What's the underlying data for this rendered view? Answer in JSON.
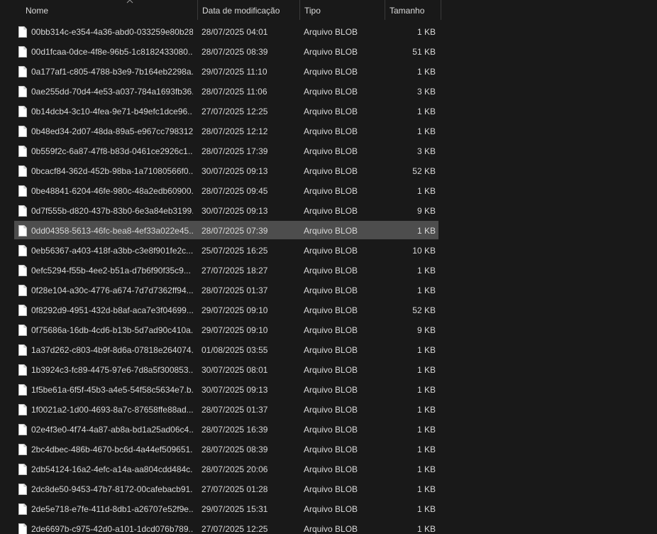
{
  "columns": {
    "name": "Nome",
    "date": "Data de modificação",
    "type": "Tipo",
    "size": "Tamanho"
  },
  "sort_icon": "sort-ascending-icon",
  "file_icon": "blank-file-icon",
  "selected_index": 10,
  "rows": [
    {
      "name": "00bb314c-e354-4a36-abd0-033259e80b28...",
      "date": "28/07/2025 04:01",
      "type": "Arquivo BLOB",
      "size": "1 KB"
    },
    {
      "name": "00d1fcaa-0dce-4f8e-96b5-1c8182433080...",
      "date": "28/07/2025 08:39",
      "type": "Arquivo BLOB",
      "size": "51 KB"
    },
    {
      "name": "0a177af1-c805-4788-b3e9-7b164eb2298a...",
      "date": "29/07/2025 11:10",
      "type": "Arquivo BLOB",
      "size": "1 KB"
    },
    {
      "name": "0ae255dd-70d4-4e53-a037-784a1693fb36...",
      "date": "28/07/2025 11:06",
      "type": "Arquivo BLOB",
      "size": "3 KB"
    },
    {
      "name": "0b14dcb4-3c10-4fea-9e71-b49efc1dce96...",
      "date": "27/07/2025 12:25",
      "type": "Arquivo BLOB",
      "size": "1 KB"
    },
    {
      "name": "0b48ed34-2d07-48da-89a5-e967cc798312...",
      "date": "28/07/2025 12:12",
      "type": "Arquivo BLOB",
      "size": "1 KB"
    },
    {
      "name": "0b559f2c-6a87-47f8-b83d-0461ce2926c1...",
      "date": "28/07/2025 17:39",
      "type": "Arquivo BLOB",
      "size": "3 KB"
    },
    {
      "name": "0bcacf84-362d-452b-98ba-1a71080566f0...",
      "date": "30/07/2025 09:13",
      "type": "Arquivo BLOB",
      "size": "52 KB"
    },
    {
      "name": "0be48841-6204-46fe-980c-48a2edb60900...",
      "date": "28/07/2025 09:45",
      "type": "Arquivo BLOB",
      "size": "1 KB"
    },
    {
      "name": "0d7f555b-d820-437b-83b0-6e3a84eb3199...",
      "date": "30/07/2025 09:13",
      "type": "Arquivo BLOB",
      "size": "9 KB"
    },
    {
      "name": "0dd04358-5613-46fc-bea8-4ef33a022e45...",
      "date": "28/07/2025 07:39",
      "type": "Arquivo BLOB",
      "size": "1 KB"
    },
    {
      "name": "0eb56367-a403-418f-a3bb-c3e8f901fe2c...",
      "date": "25/07/2025 16:25",
      "type": "Arquivo BLOB",
      "size": "10 KB"
    },
    {
      "name": "0efc5294-f55b-4ee2-b51a-d7b6f90f35c9...",
      "date": "27/07/2025 18:27",
      "type": "Arquivo BLOB",
      "size": "1 KB"
    },
    {
      "name": "0f28e104-a30c-4776-a674-7d7d7362ff94...",
      "date": "28/07/2025 01:37",
      "type": "Arquivo BLOB",
      "size": "1 KB"
    },
    {
      "name": "0f8292d9-4951-432d-b8af-aca7e3f04699...",
      "date": "29/07/2025 09:10",
      "type": "Arquivo BLOB",
      "size": "52 KB"
    },
    {
      "name": "0f75686a-16db-4cd6-b13b-5d7ad90c410a...",
      "date": "29/07/2025 09:10",
      "type": "Arquivo BLOB",
      "size": "9 KB"
    },
    {
      "name": "1a37d262-c803-4b9f-8d6a-07818e264074...",
      "date": "01/08/2025 03:55",
      "type": "Arquivo BLOB",
      "size": "1 KB"
    },
    {
      "name": "1b3924c3-fc89-4475-97e6-7d8a5f300853...",
      "date": "30/07/2025 08:01",
      "type": "Arquivo BLOB",
      "size": "1 KB"
    },
    {
      "name": "1f5be61a-6f5f-45b3-a4e5-54f58c5634e7.b...",
      "date": "30/07/2025 09:13",
      "type": "Arquivo BLOB",
      "size": "1 KB"
    },
    {
      "name": "1f0021a2-1d00-4693-8a7c-87658ffe88ad....",
      "date": "28/07/2025 01:37",
      "type": "Arquivo BLOB",
      "size": "1 KB"
    },
    {
      "name": "02e4f3e0-4f74-4a87-ab8a-bd1a25ad06c4....",
      "date": "28/07/2025 16:39",
      "type": "Arquivo BLOB",
      "size": "1 KB"
    },
    {
      "name": "2bc4dbec-486b-4670-bc6d-4a44ef509651...",
      "date": "28/07/2025 08:39",
      "type": "Arquivo BLOB",
      "size": "1 KB"
    },
    {
      "name": "2db54124-16a2-4efc-a14a-aa804cdd484c....",
      "date": "28/07/2025 20:06",
      "type": "Arquivo BLOB",
      "size": "1 KB"
    },
    {
      "name": "2dc8de50-9453-47b7-8172-00cafebacb91...",
      "date": "27/07/2025 01:28",
      "type": "Arquivo BLOB",
      "size": "1 KB"
    },
    {
      "name": "2de5e718-e7fe-411d-8db1-a26707e52f9e....",
      "date": "29/07/2025 15:31",
      "type": "Arquivo BLOB",
      "size": "1 KB"
    },
    {
      "name": "2de6697b-c975-42d0-a101-1dcd076b789...",
      "date": "27/07/2025 12:25",
      "type": "Arquivo BLOB",
      "size": "1 KB"
    }
  ]
}
